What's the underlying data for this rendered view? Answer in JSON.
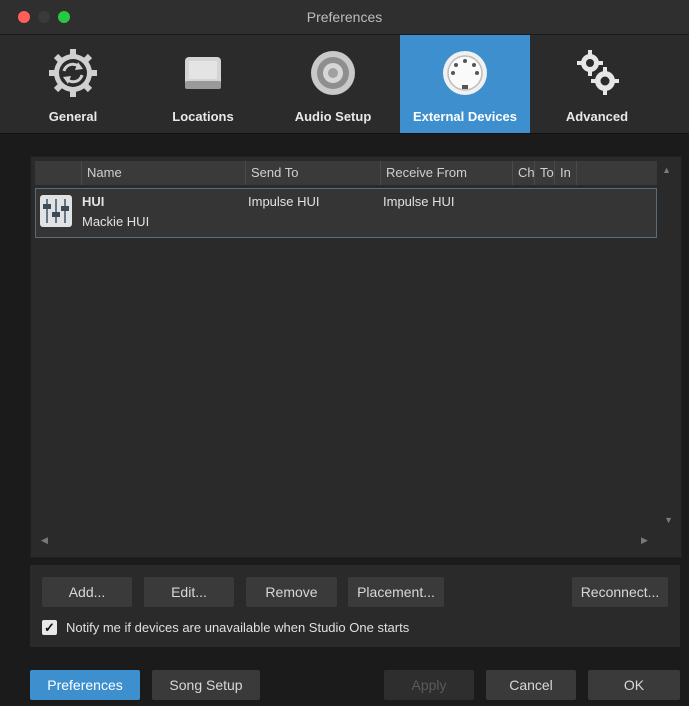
{
  "window": {
    "title": "Preferences"
  },
  "tabs": [
    {
      "label": "General",
      "icon": "sync-gear-icon"
    },
    {
      "label": "Locations",
      "icon": "drive-icon"
    },
    {
      "label": "Audio Setup",
      "icon": "speaker-icon"
    },
    {
      "label": "External Devices",
      "icon": "midi-port-icon",
      "active": true
    },
    {
      "label": "Advanced",
      "icon": "gears-icon"
    }
  ],
  "table": {
    "columns": [
      "Name",
      "Send To",
      "Receive From",
      "Ch",
      "To",
      "In"
    ],
    "rows": [
      {
        "name": "HUI",
        "subtitle": "Mackie HUI",
        "send_to": "Impulse HUI",
        "receive_from": "Impulse HUI",
        "icon": "mixer-faders-icon"
      }
    ]
  },
  "buttons": {
    "add": "Add...",
    "edit": "Edit...",
    "remove": "Remove",
    "placement": "Placement...",
    "reconnect": "Reconnect..."
  },
  "notify": {
    "label": "Notify me if devices are unavailable when Studio One starts",
    "checked": true
  },
  "bottom": {
    "preferences": "Preferences",
    "song_setup": "Song Setup",
    "apply": "Apply",
    "cancel": "Cancel",
    "ok": "OK"
  },
  "colors": {
    "accent": "#3d8fce",
    "background": "#1b1b1b",
    "panel": "#2a2a2a"
  }
}
